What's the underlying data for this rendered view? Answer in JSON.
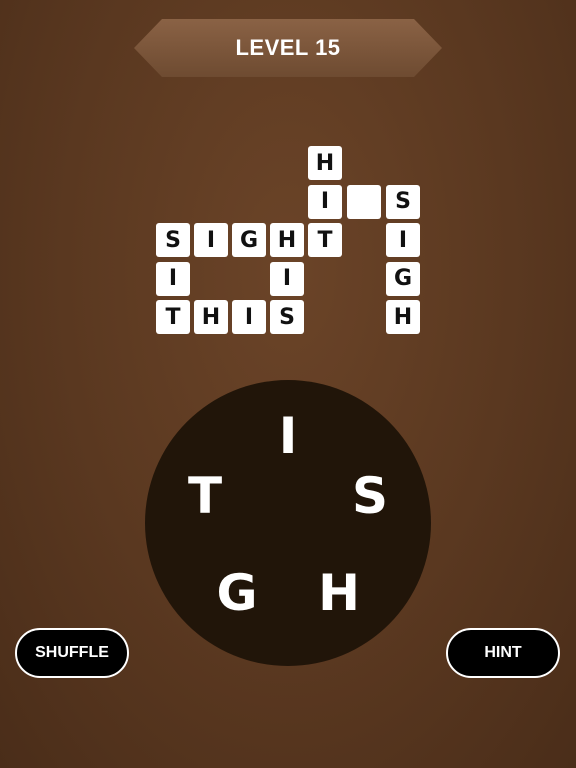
{
  "header": {
    "title": "LEVEL 15"
  },
  "grid": {
    "rows": [
      [
        "",
        "",
        "",
        "",
        "",
        "",
        "",
        "",
        "",
        "",
        ""
      ],
      [
        "",
        "",
        "",
        "",
        "",
        "",
        "",
        "",
        "",
        "",
        ""
      ],
      [
        "",
        "",
        "",
        "",
        "",
        "",
        "",
        "",
        "",
        "",
        ""
      ],
      [
        "",
        "",
        "",
        "",
        "",
        "",
        "",
        "",
        "",
        "",
        ""
      ],
      [
        "",
        "",
        "",
        "",
        "",
        "",
        "",
        "",
        "",
        "",
        ""
      ]
    ],
    "tiles": [
      {
        "row": 0,
        "col": 4,
        "letter": "H"
      },
      {
        "row": 1,
        "col": 4,
        "letter": "I"
      },
      {
        "row": 1,
        "col": 5,
        "letter": ""
      },
      {
        "row": 1,
        "col": 6,
        "letter": "S"
      },
      {
        "row": 2,
        "col": 0,
        "letter": "S"
      },
      {
        "row": 2,
        "col": 1,
        "letter": "I"
      },
      {
        "row": 2,
        "col": 2,
        "letter": "G"
      },
      {
        "row": 2,
        "col": 3,
        "letter": "H"
      },
      {
        "row": 2,
        "col": 4,
        "letter": "T"
      },
      {
        "row": 2,
        "col": 6,
        "letter": "I"
      },
      {
        "row": 3,
        "col": 0,
        "letter": "I"
      },
      {
        "row": 3,
        "col": 3,
        "letter": "I"
      },
      {
        "row": 3,
        "col": 6,
        "letter": "G"
      },
      {
        "row": 4,
        "col": 0,
        "letter": "T"
      },
      {
        "row": 4,
        "col": 1,
        "letter": "H"
      },
      {
        "row": 4,
        "col": 2,
        "letter": "I"
      },
      {
        "row": 4,
        "col": 3,
        "letter": "S"
      },
      {
        "row": 4,
        "col": 6,
        "letter": "H"
      }
    ]
  },
  "wheel": {
    "letters": [
      "I",
      "S",
      "H",
      "G",
      "T"
    ]
  },
  "buttons": {
    "shuffle_label": "SHUFFLE",
    "hint_label": "HINT"
  }
}
